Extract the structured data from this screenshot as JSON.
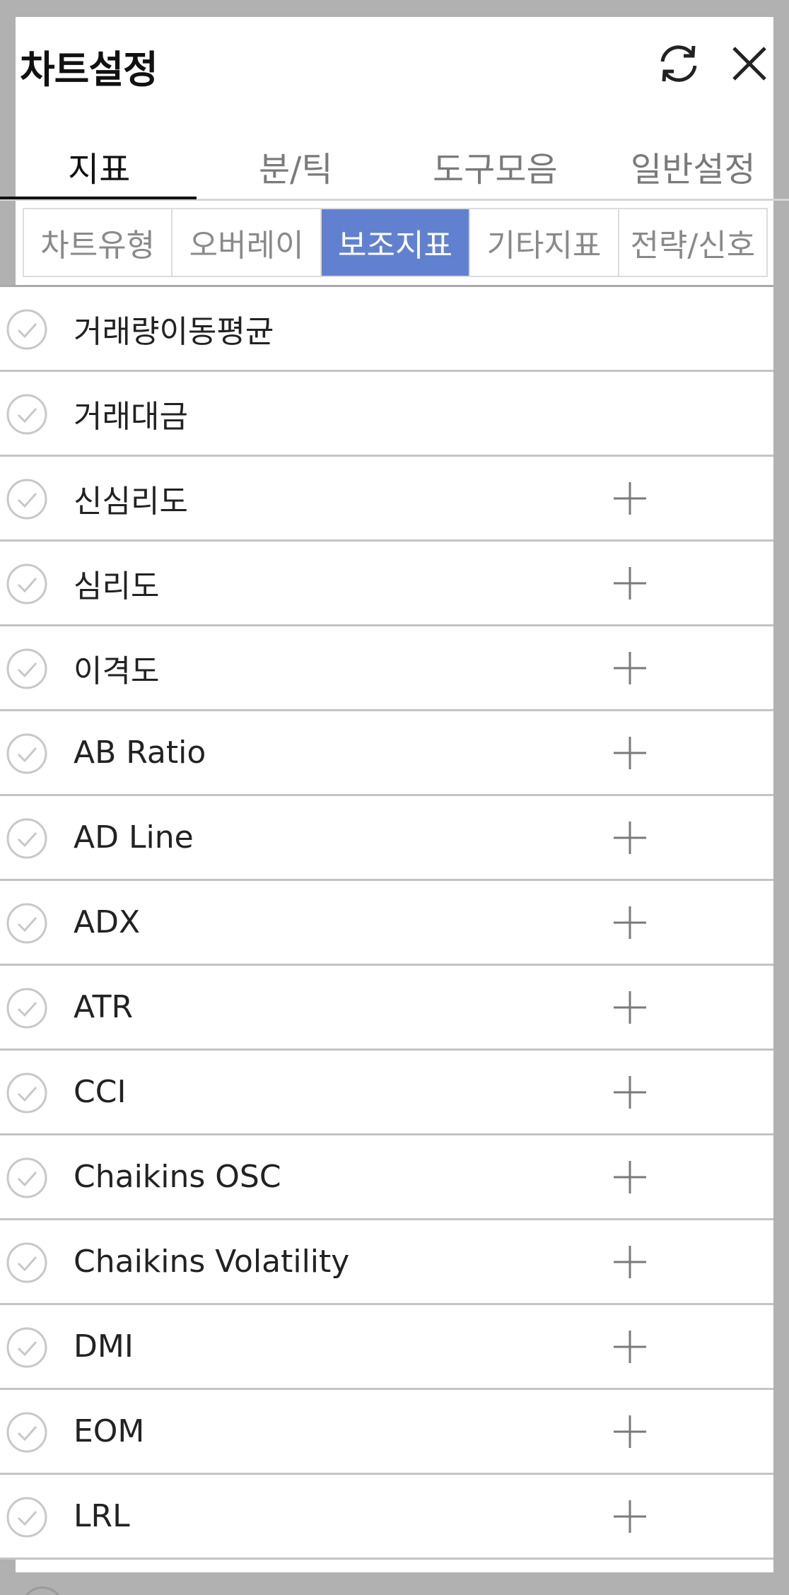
{
  "header": {
    "title": "차트설정",
    "refresh_icon": "refresh-icon",
    "close_icon": "close-icon"
  },
  "main_tabs": [
    {
      "label": "지표",
      "active": true
    },
    {
      "label": "분/틱",
      "active": false
    },
    {
      "label": "도구모음",
      "active": false
    },
    {
      "label": "일반설정",
      "active": false
    }
  ],
  "sub_tabs": [
    {
      "label": "차트유형",
      "active": false
    },
    {
      "label": "오버레이",
      "active": false
    },
    {
      "label": "보조지표",
      "active": true
    },
    {
      "label": "기타지표",
      "active": false
    },
    {
      "label": "전략/신호",
      "active": false
    }
  ],
  "indicators": [
    {
      "label": "거래량이동평균",
      "addable": false
    },
    {
      "label": "거래대금",
      "addable": false
    },
    {
      "label": "신심리도",
      "addable": true
    },
    {
      "label": "심리도",
      "addable": true
    },
    {
      "label": "이격도",
      "addable": true
    },
    {
      "label": "AB Ratio",
      "addable": true
    },
    {
      "label": "AD Line",
      "addable": true
    },
    {
      "label": "ADX",
      "addable": true
    },
    {
      "label": "ATR",
      "addable": true
    },
    {
      "label": "CCI",
      "addable": true
    },
    {
      "label": "Chaikins OSC",
      "addable": true
    },
    {
      "label": "Chaikins Volatility",
      "addable": true
    },
    {
      "label": "DMI",
      "addable": true
    },
    {
      "label": "EOM",
      "addable": true
    },
    {
      "label": "LRL",
      "addable": true
    }
  ],
  "colors": {
    "accent": "#6181d0",
    "backdrop": "#b1b1b1"
  }
}
